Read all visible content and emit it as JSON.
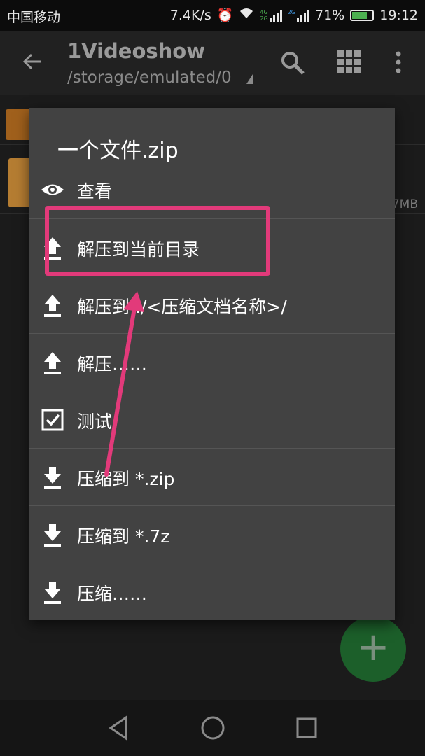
{
  "status_bar": {
    "carrier": "中国移动",
    "speed": "7.4K/s",
    "net_4g": "4G",
    "net_2g_a": "2G",
    "net_2g_b": "2G",
    "battery": "71%",
    "time": "19:12"
  },
  "app_bar": {
    "title": "1Videoshow",
    "path": "/storage/emulated/0",
    "icons": [
      "back-arrow-icon",
      "search-icon",
      "grid-view-icon",
      "more-vert-icon"
    ]
  },
  "file_list": {
    "visible_size": "7MB"
  },
  "dialog": {
    "title": "一个文件.zip",
    "items": [
      {
        "label": "查看",
        "icon": "eye-icon"
      },
      {
        "label": "解压到当前目录",
        "icon": "upload-icon"
      },
      {
        "label": "解压到 ./<压缩文档名称>/",
        "icon": "upload-icon"
      },
      {
        "label": "解压……",
        "icon": "upload-icon"
      },
      {
        "label": "测试",
        "icon": "checkbox-icon"
      },
      {
        "label": "压缩到 *.zip",
        "icon": "download-icon"
      },
      {
        "label": "压缩到 *.7z",
        "icon": "download-icon"
      },
      {
        "label": "压缩……",
        "icon": "download-icon"
      }
    ]
  },
  "fab": {
    "label": "+"
  },
  "colors": {
    "highlight": "#e23a7a",
    "dialog_bg": "#424242",
    "fab": "#1c5f2a"
  }
}
